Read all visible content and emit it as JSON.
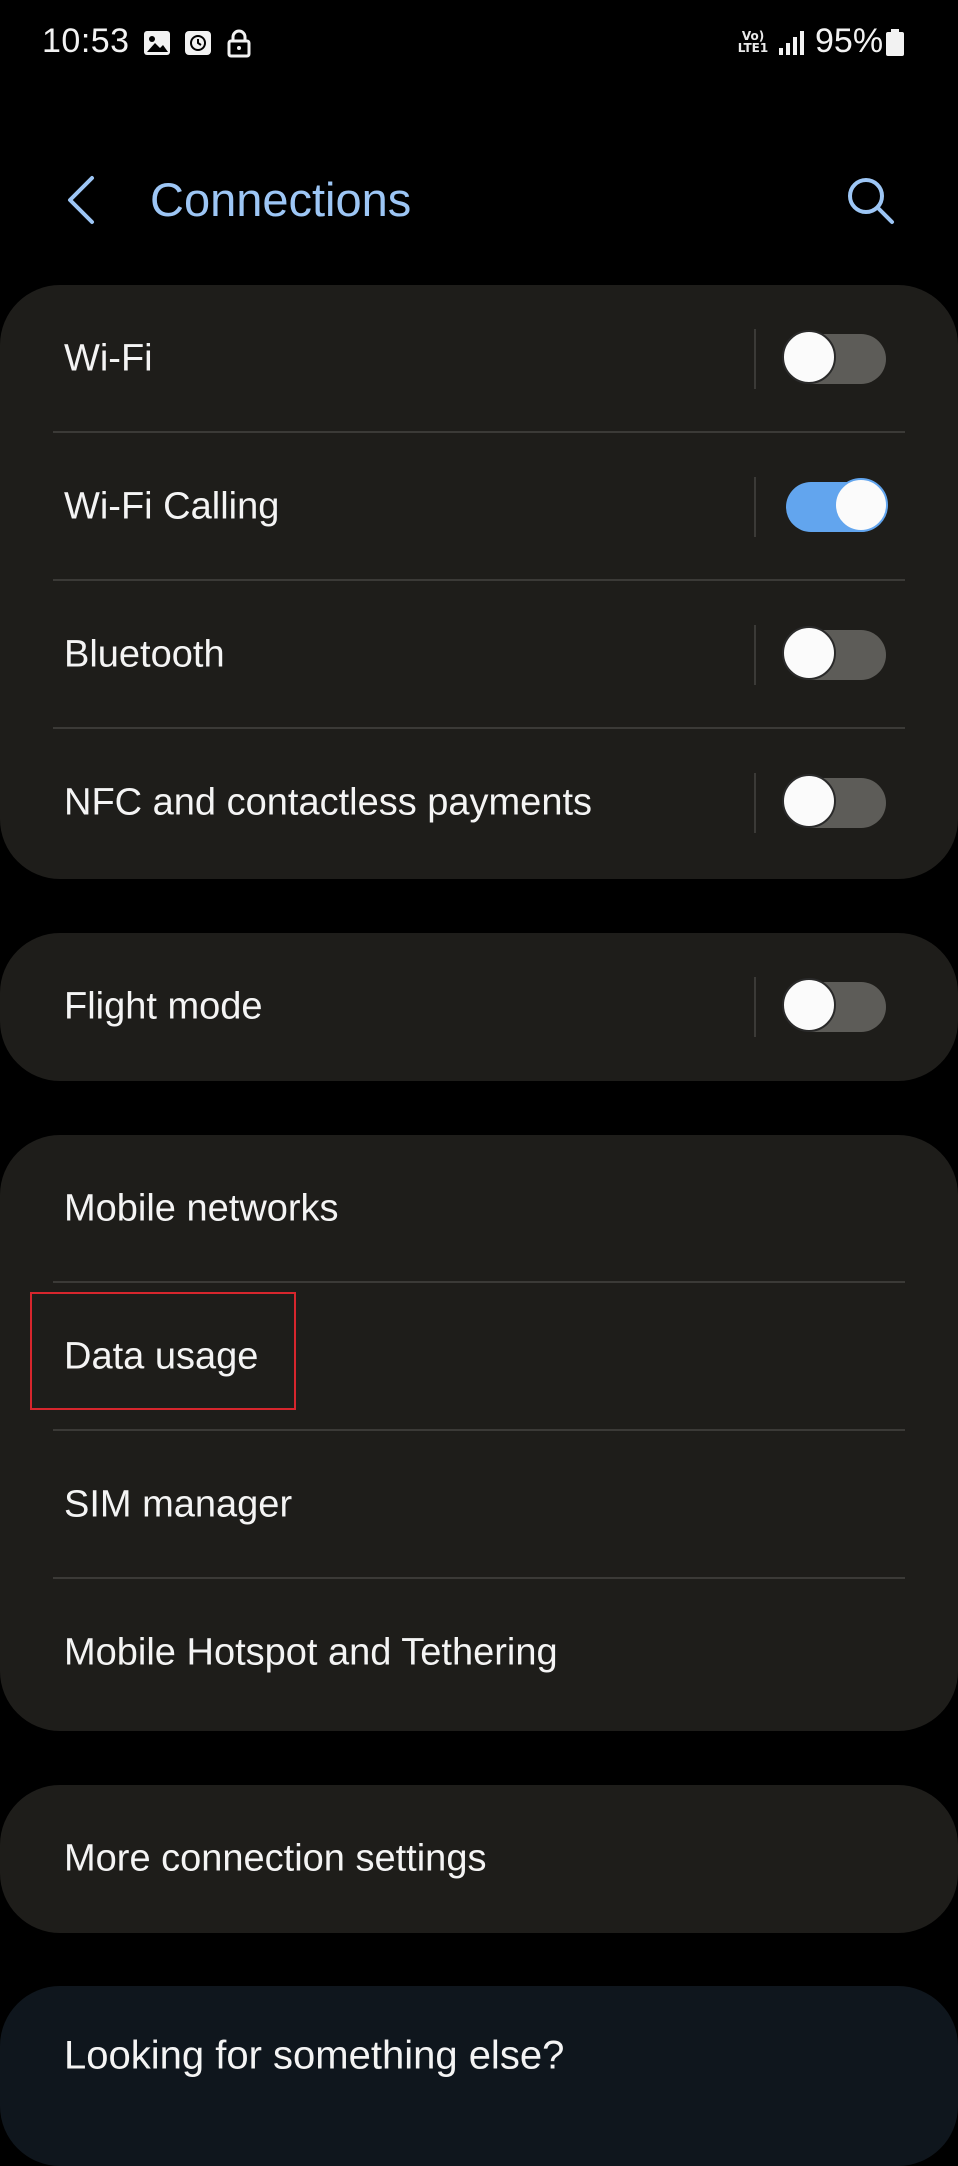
{
  "status_bar": {
    "time": "10:53",
    "network_label_top": "Vo)",
    "network_label_bottom": "LTE1",
    "battery": "95%",
    "icons": [
      "gallery-icon",
      "clock-app-icon",
      "lock-icon",
      "signal-icon",
      "battery-icon"
    ]
  },
  "header": {
    "title": "Connections",
    "back_icon": "chevron-left-icon",
    "search_icon": "search-icon"
  },
  "colors": {
    "title": "#9dc6f5",
    "toggle_on": "#62a5ee",
    "toggle_off": "#5d5c58",
    "card_bg": "#1e1d1a",
    "highlight": "#d7262d"
  },
  "groups": {
    "wireless": [
      {
        "label": "Wi-Fi",
        "toggle": false
      },
      {
        "label": "Wi-Fi Calling",
        "toggle": true
      },
      {
        "label": "Bluetooth",
        "toggle": false
      },
      {
        "label": "NFC and contactless payments",
        "toggle": false
      }
    ],
    "flight": [
      {
        "label": "Flight mode",
        "toggle": false
      }
    ],
    "mobile": [
      {
        "label": "Mobile networks"
      },
      {
        "label": "Data usage"
      },
      {
        "label": "SIM manager"
      },
      {
        "label": "Mobile Hotspot and Tethering"
      }
    ],
    "more": [
      {
        "label": "More connection settings"
      }
    ]
  },
  "help": {
    "title": "Looking for something else?"
  }
}
